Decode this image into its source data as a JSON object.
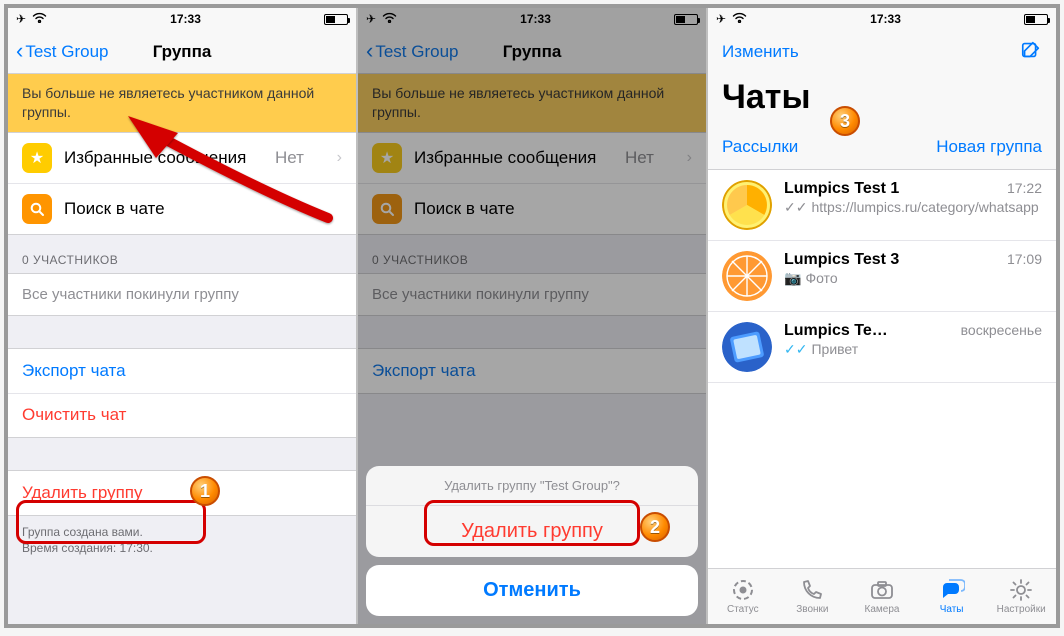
{
  "statusbar": {
    "time": "17:33"
  },
  "screen1": {
    "back_label": "Test Group",
    "title": "Группа",
    "banner": "Вы больше не являетесь участником данной группы.",
    "starred_label": "Избранные сообщения",
    "starred_aux": "Нет",
    "search_label": "Поиск в чате",
    "participants_header": "0 УЧАСТНИКОВ",
    "participants_empty": "Все участники покинули группу",
    "export_label": "Экспорт чата",
    "clear_label": "Очистить чат",
    "delete_label": "Удалить группу",
    "footer_line1": "Группа создана вами.",
    "footer_line2": "Время создания: 17:30.",
    "badge": "1"
  },
  "screen2": {
    "back_label": "Test Group",
    "title": "Группа",
    "banner": "Вы больше не являетесь участником данной группы.",
    "starred_label": "Избранные сообщения",
    "starred_aux": "Нет",
    "search_label": "Поиск в чате",
    "participants_header": "0 УЧАСТНИКОВ",
    "participants_empty": "Все участники покинули группу",
    "export_label": "Экспорт чата",
    "sheet_title": "Удалить группу \"Test Group\"?",
    "sheet_delete": "Удалить группу",
    "sheet_cancel": "Отменить",
    "badge": "2"
  },
  "screen3": {
    "edit_label": "Изменить",
    "page_title": "Чаты",
    "quick_left": "Рассылки",
    "quick_right": "Новая группа",
    "badge": "3",
    "chats": [
      {
        "title": "Lumpics Test 1",
        "time": "17:22",
        "tick": "gray",
        "sub": "https://lumpics.ru/category/whatsapp"
      },
      {
        "title": "Lumpics Test 3",
        "time": "17:09",
        "sub_icon": "camera",
        "sub": "Фото"
      },
      {
        "title": "Lumpics Te…",
        "time": "воскресенье",
        "tick": "blue",
        "sub": "Привет"
      }
    ],
    "tabs": {
      "status": "Статус",
      "calls": "Звонки",
      "camera": "Камера",
      "chats": "Чаты",
      "settings": "Настройки"
    }
  }
}
